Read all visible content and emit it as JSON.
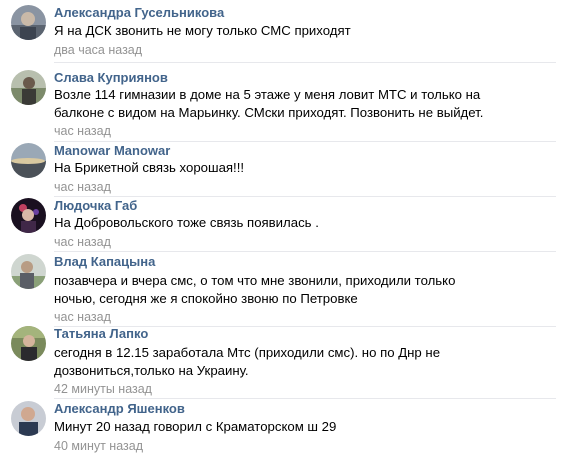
{
  "comments": [
    {
      "author": "Александра Гусельникова",
      "text": "Я на ДСК звонить не могу только СМС приходят",
      "time": "два часа назад"
    },
    {
      "author": "Слава Куприянов",
      "text": "Возле 114 гимназии в доме на 5 этаже у меня ловит МТС и только на\nбалконе с видом на Марьинку. СМски приходят. Позвонить не выйдет.",
      "time": "час назад"
    },
    {
      "author": "Manowar Manowar",
      "text": "На Брикетной связь хорошая!!!",
      "time": "час назад"
    },
    {
      "author": "Людочка Габ",
      "text": "На Добровольского тоже связь появилась .",
      "time": "час назад"
    },
    {
      "author": "Влад Капацына",
      "text": "позавчера и вчера смс, о том что мне звонили, приходили только\nночью, сегодня же я спокойно звоню по Петровке",
      "time": "час назад"
    },
    {
      "author": "Татьяна Лапко",
      "text": "сегодня в 12.15 заработала Мтс (приходили смс). но по Днр не\nдозвониться,только на Украину.",
      "time": "42 минуты назад"
    },
    {
      "author": "Александр Яшенков",
      "text": "Минут 20 назад говорил с Краматорском ш 29",
      "time": "40 минут назад"
    }
  ],
  "colors": {
    "author": "#42648b",
    "text": "#000000",
    "time": "#939393",
    "divider": "#e7e8ec"
  }
}
